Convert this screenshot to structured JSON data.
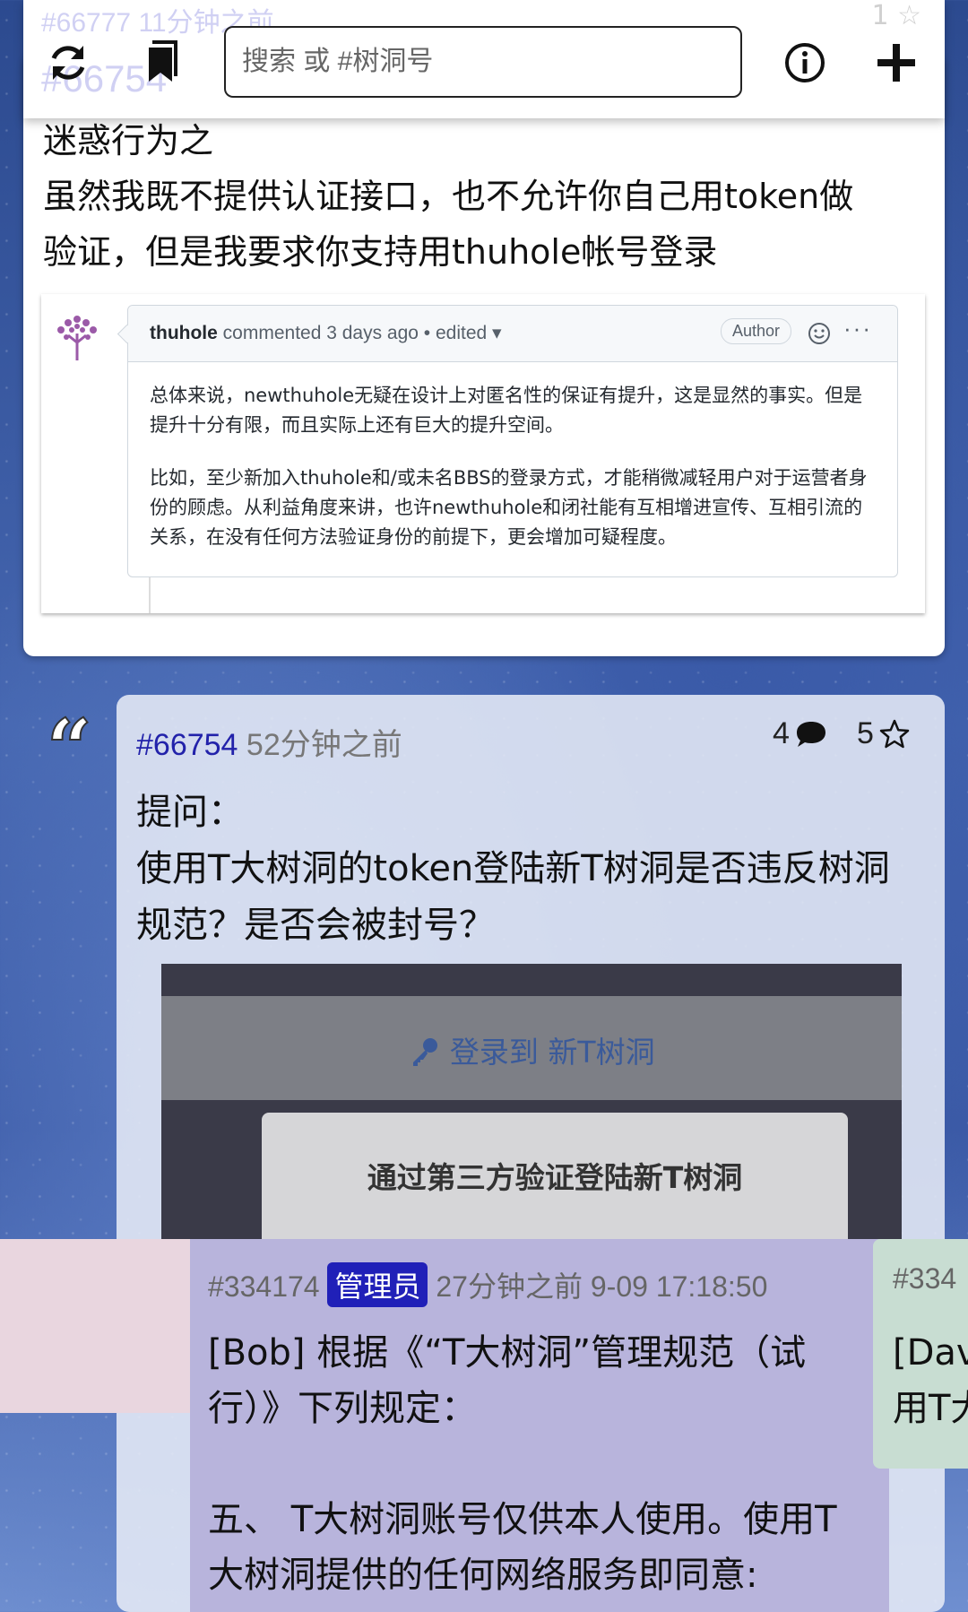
{
  "topbar": {
    "search_placeholder": "搜索 或 #树洞号",
    "ghost_prev_id": "#66777",
    "ghost_prev_time": "11分钟之前",
    "ghost_prev_star": "1",
    "ghost_id": "#66754",
    "icons": [
      "refresh-icon",
      "bookmark-icon",
      "info-icon",
      "plus-icon"
    ]
  },
  "post1": {
    "text_lines": [
      "迷惑行为之",
      "虽然我既不提供认证接口，也不允许你自己用token做",
      "验证，但是我要求你支持用thuhole帐号登录"
    ],
    "github": {
      "user": "thuhole",
      "action": "commented 3 days ago • edited",
      "author_badge": "Author",
      "para1": "总体来说，newthuhole无疑在设计上对匿名性的保证有提升，这是显然的事实。但是提升十分有限，而且实际上还有巨大的提升空间。",
      "para2": "比如，至少新加入thuhole和/或未名BBS的登录方式，才能稍微减轻用户对于运营者身份的顾虑。从利益角度来讲，也许newthuhole和闭社能有互相增进宣传、互相引流的关系，在没有任何方法验证身份的前提下，更会增加可疑程度。"
    }
  },
  "post2": {
    "id": "#66754",
    "time": "52分钟之前",
    "reply_count": "4",
    "star_count": "5",
    "text_lines": [
      "提问：",
      "使用T大树洞的token登陆新T树洞是否违反树洞",
      "规范？是否会被封号？"
    ],
    "screenshot": {
      "login_title": "登录到 新T树洞",
      "dialog_title": "通过第三方验证登陆新T树洞"
    }
  },
  "reply": {
    "id": "#334174",
    "badge": "管理员",
    "time_rel": "27分钟之前",
    "time_abs": "9-09 17:18:50",
    "text": "[Bob] 根据《“T大树洞”管理规范（试\n行）》下列规定：\n\n五、 T大树洞账号仅供本人使用。使用T\n大树洞提供的任何网络服务即同意:"
  },
  "reply2": {
    "id": "#334",
    "text": "[Dav\n用T大"
  },
  "colors": {
    "accent": "#2222aa",
    "badge": "#2020b8"
  }
}
